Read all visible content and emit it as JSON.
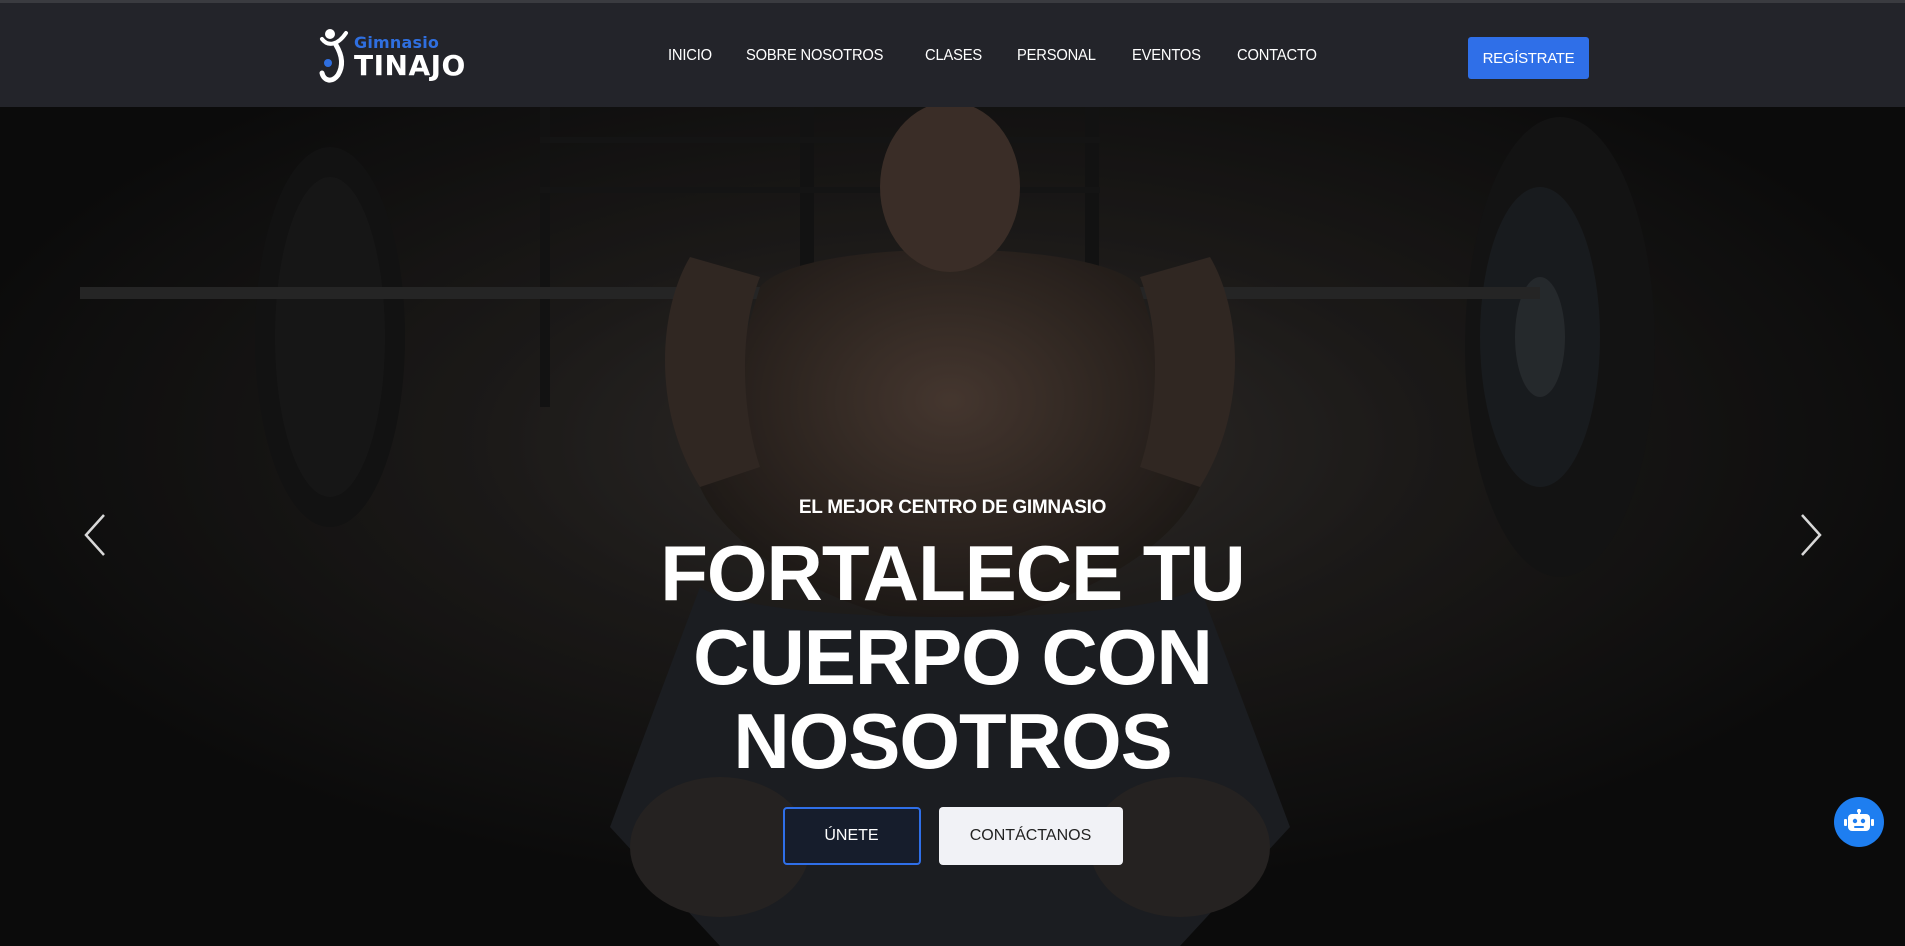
{
  "logo": {
    "small_text": "Gimnasio",
    "big_text": "TINAJO"
  },
  "nav": {
    "items": [
      {
        "label": "INICIO"
      },
      {
        "label": "SOBRE NOSOTROS"
      },
      {
        "label": "CLASES"
      },
      {
        "label": "PERSONAL"
      },
      {
        "label": "EVENTOS"
      },
      {
        "label": "CONTACTO"
      }
    ]
  },
  "header": {
    "register_label": "REGÍSTRATE"
  },
  "hero": {
    "subtitle": "EL MEJOR CENTRO DE GIMNASIO",
    "title_line1": "FORTALECE TU CUERPO CON",
    "title_line2": "NOSOTROS",
    "join_label": "ÚNETE",
    "contact_label": "CONTÁCTANOS"
  },
  "icons": {
    "prev": "chevron-left-icon",
    "next": "chevron-right-icon",
    "bot": "robot-icon"
  },
  "colors": {
    "accent": "#2f6fe8",
    "header_bg": "#23242a",
    "bot_bg": "#1e7ef0"
  }
}
